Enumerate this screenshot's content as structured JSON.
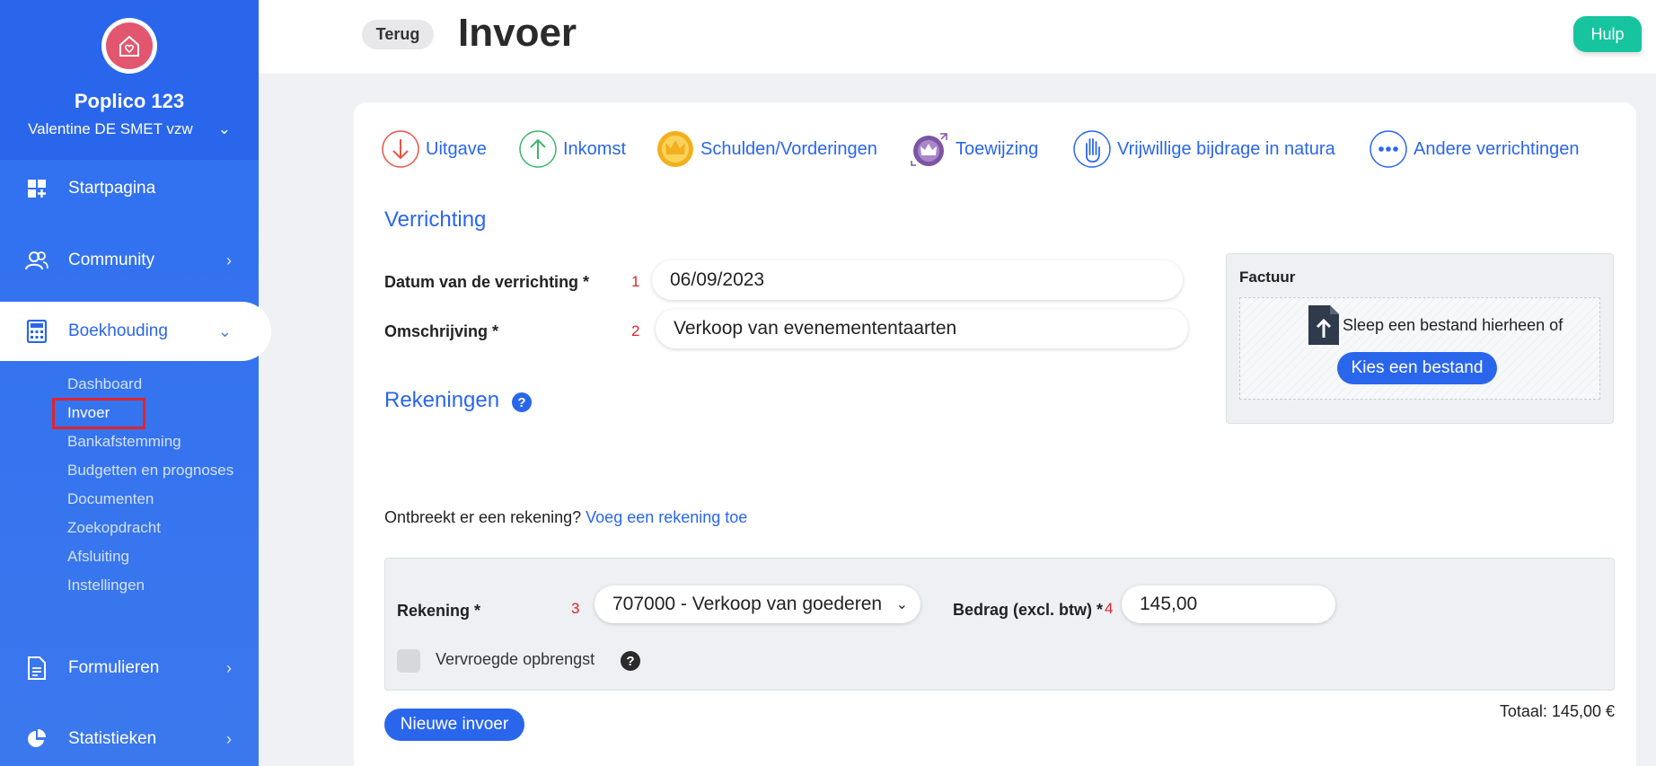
{
  "sidebar": {
    "org_name": "Poplico 123",
    "org_sub": "Valentine DE SMET vzw",
    "nav": [
      {
        "label": "Startpagina",
        "icon": "dashboard-icon"
      },
      {
        "label": "Community",
        "icon": "users-icon"
      },
      {
        "label": "Boekhouding",
        "icon": "calculator-icon"
      },
      {
        "label": "Formulieren",
        "icon": "document-icon"
      },
      {
        "label": "Statistieken",
        "icon": "pie-chart-icon"
      }
    ],
    "sub_items": [
      "Dashboard",
      "Invoer",
      "Bankafstemming",
      "Budgetten en prognoses",
      "Documenten",
      "Zoekopdracht",
      "Afsluiting",
      "Instellingen"
    ]
  },
  "header": {
    "back_label": "Terug",
    "title": "Invoer",
    "help_label": "Hulp"
  },
  "types": [
    {
      "label": "Uitgave",
      "icon": "arrow-down-icon",
      "color": "#e4574a"
    },
    {
      "label": "Inkomst",
      "icon": "arrow-up-icon",
      "color": "#3fb56b"
    },
    {
      "label": "Schulden/Vorderingen",
      "icon": "crown-icon",
      "color": "#f2b01e"
    },
    {
      "label": "Toewijzing",
      "icon": "crown-transfer-icon",
      "color": "#7d55a5"
    },
    {
      "label": "Vrijwillige bijdrage in natura",
      "icon": "hand-icon",
      "color": "#2a66ec"
    },
    {
      "label": "Andere verrichtingen",
      "icon": "more-icon",
      "color": "#2a66ec"
    }
  ],
  "verrichting": {
    "title": "Verrichting",
    "date_label": "Datum van de verrichting *",
    "date_num": "1",
    "date_value": "06/09/2023",
    "desc_label": "Omschrijving *",
    "desc_num": "2",
    "desc_value": "Verkoop van evenemententaarten"
  },
  "invoice": {
    "title": "Factuur",
    "drop_text": "Sleep een bestand hierheen of",
    "choose_label": "Kies een bestand"
  },
  "rekeningen": {
    "title": "Rekeningen",
    "help": "?",
    "missing_text": "Ontbreekt er een rekening?",
    "missing_link": "Voeg een rekening toe",
    "account_label": "Rekening *",
    "account_num": "3",
    "account_value": "707000 - Verkoop van goederen",
    "amount_label": "Bedrag (excl. btw) *",
    "amount_num": "4",
    "amount_value": "145,00",
    "checkbox_label": "Vervroegde opbrengst",
    "checkbox_help": "?"
  },
  "footer": {
    "new_label": "Nieuwe invoer",
    "total": "Totaal: 145,00 €"
  },
  "colors": {
    "accent": "#2a66ec",
    "help_button": "#16c5a0",
    "marker_red": "#e0242b"
  }
}
